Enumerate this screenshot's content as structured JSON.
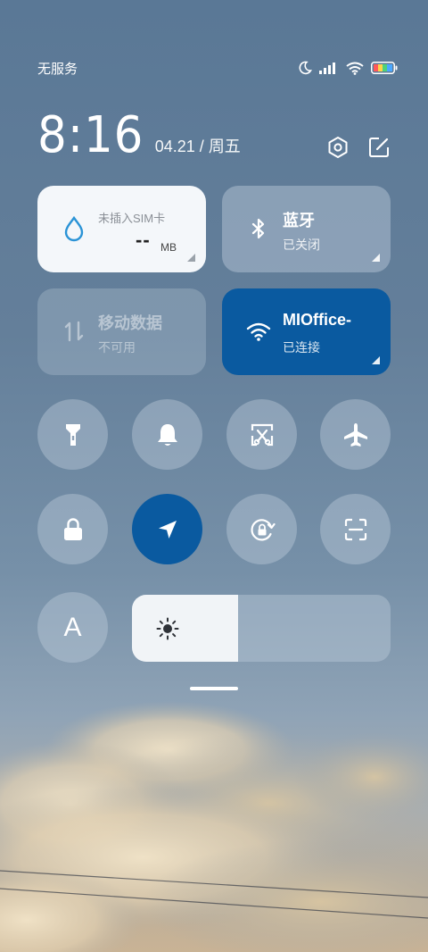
{
  "status_bar": {
    "carrier": "无服务",
    "icons": [
      "moon-icon",
      "signal-icon",
      "wifi-icon",
      "battery-icon"
    ]
  },
  "header": {
    "time": "8:16",
    "date": "04.21 / 周五",
    "actions": [
      "settings-icon",
      "edit-icon"
    ]
  },
  "tiles": {
    "data": {
      "title": "未插入SIM卡",
      "value": "--",
      "unit": "MB",
      "icon": "water-drop-icon"
    },
    "bluetooth": {
      "title": "蓝牙",
      "status": "已关闭",
      "icon": "bluetooth-icon"
    },
    "mobile_data": {
      "title": "移动数据",
      "status": "不可用",
      "icon": "mobile-data-icon"
    },
    "wifi": {
      "title": "MIOffice-",
      "status": "已连接",
      "icon": "wifi-icon"
    }
  },
  "toggles": [
    {
      "name": "flashlight-icon",
      "active": false
    },
    {
      "name": "bell-icon",
      "active": false
    },
    {
      "name": "screenshot-icon",
      "active": false
    },
    {
      "name": "airplane-icon",
      "active": false
    },
    {
      "name": "lock-icon",
      "active": false
    },
    {
      "name": "location-icon",
      "active": true
    },
    {
      "name": "rotation-lock-icon",
      "active": false
    },
    {
      "name": "scan-icon",
      "active": false
    }
  ],
  "auto_brightness_label": "A",
  "brightness": {
    "level": 0.41
  },
  "colors": {
    "accent": "#0a5aa0",
    "tile_light": "#f4f7fa",
    "data_icon": "#2a93d6"
  }
}
